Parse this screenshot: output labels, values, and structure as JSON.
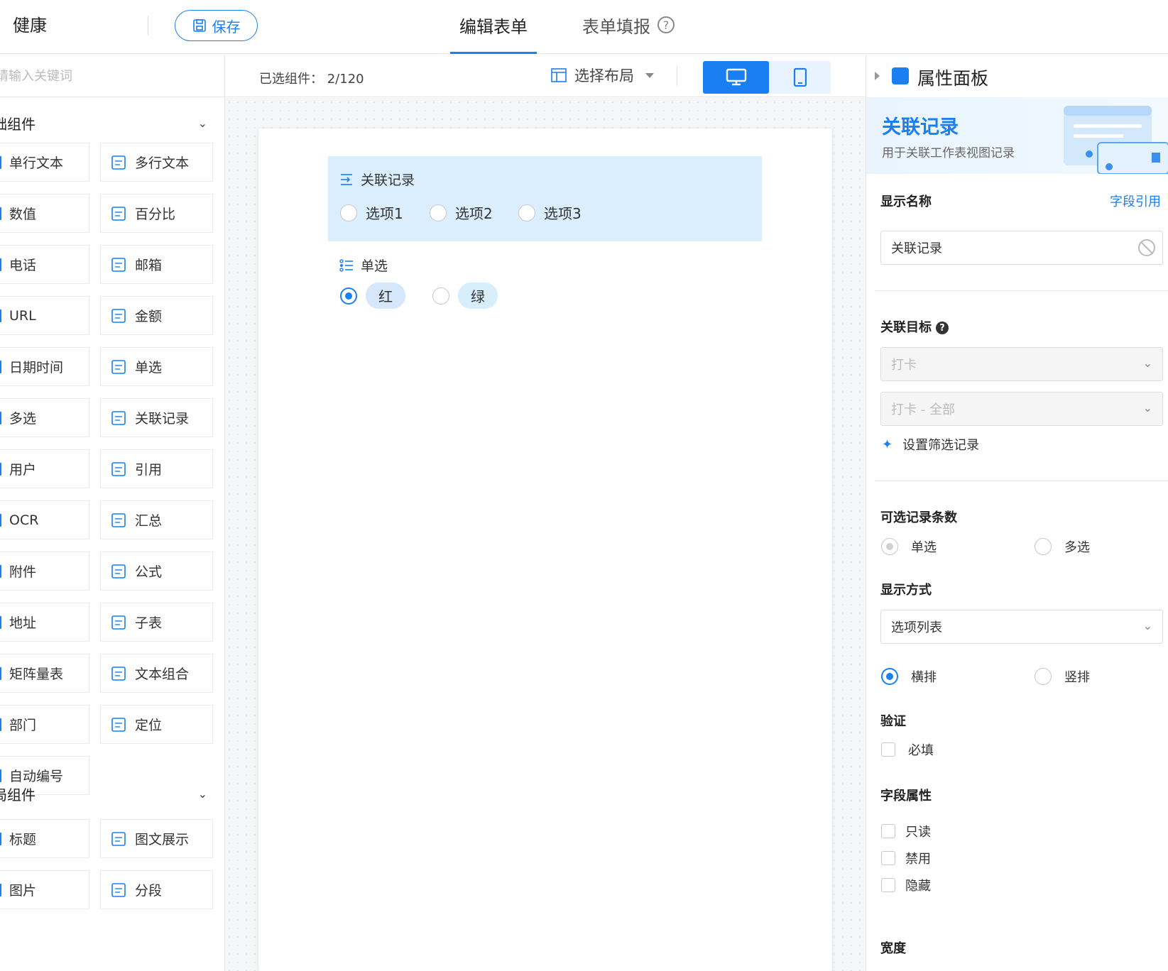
{
  "app": {
    "title": "健康",
    "save_label": "保存"
  },
  "tabs": {
    "edit": "编辑表单",
    "fill": "表单填报",
    "help": "?"
  },
  "left": {
    "search_placeholder": "请输入关键词",
    "group1": "础组件",
    "group2": "局组件",
    "components_a": [
      [
        "单行文本",
        "多行文本"
      ],
      [
        "数值",
        "百分比"
      ],
      [
        "电话",
        "邮箱"
      ],
      [
        "URL",
        "金额"
      ],
      [
        "日期时间",
        "单选"
      ],
      [
        "多选",
        "关联记录"
      ],
      [
        "用户",
        "引用"
      ],
      [
        "OCR",
        "汇总"
      ],
      [
        "附件",
        "公式"
      ],
      [
        "地址",
        "子表"
      ],
      [
        "矩阵量表",
        "文本组合"
      ],
      [
        "部门",
        "定位"
      ],
      [
        "自动编号",
        ""
      ]
    ],
    "components_b": [
      [
        "标题",
        "图文展示"
      ],
      [
        "图片",
        "分段"
      ]
    ]
  },
  "toolbar": {
    "selected_count": "已选组件：  2/120",
    "layout_label": "选择布局"
  },
  "canvas": {
    "field1": {
      "label": "关联记录",
      "options": [
        "选项1",
        "选项2",
        "选项3"
      ]
    },
    "field2": {
      "label": "单选",
      "options": [
        "红",
        "绿"
      ],
      "selected": "红"
    }
  },
  "right": {
    "panel_title": "属性面板",
    "banner_title": "关联记录",
    "banner_sub": "用于关联工作表视图记录",
    "display_name_label": "显示名称",
    "field_ref_link": "字段引用",
    "display_name_value": "关联记录",
    "target_label": "关联目标",
    "target_help": "?",
    "target_sheet": "打卡",
    "target_view": "打卡 - 全部",
    "filter_link": "设置筛选记录",
    "count_label": "可选记录条数",
    "count_opts": [
      "单选",
      "多选"
    ],
    "display_mode_label": "显示方式",
    "display_mode_value": "选项列表",
    "orient_opts": [
      "横排",
      "竖排"
    ],
    "validate_label": "验证",
    "required_label": "必填",
    "field_attr_label": "字段属性",
    "attr_opts": [
      "只读",
      "禁用",
      "隐藏"
    ],
    "width_label": "宽度"
  },
  "colors": {
    "accent": "#1a7ff0",
    "selected_bg": "#daeefd"
  }
}
